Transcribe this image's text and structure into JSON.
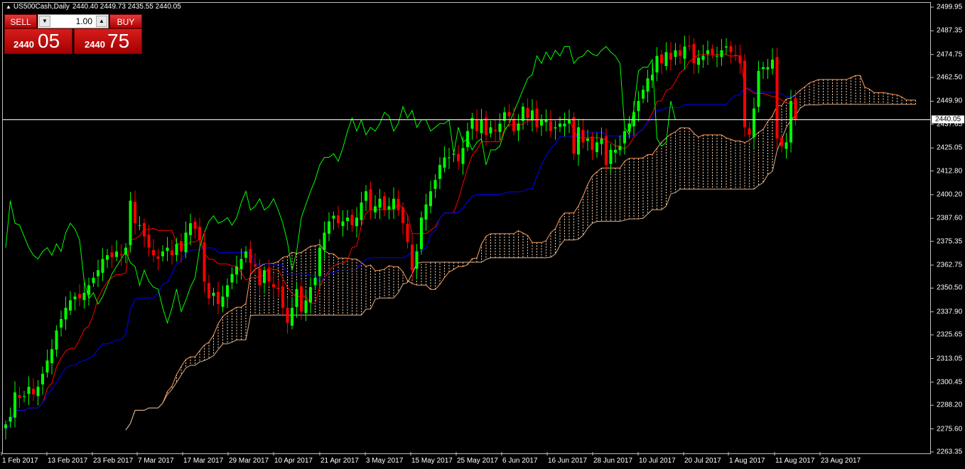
{
  "window": {
    "symbol": "US500Cash,Daily",
    "ohlc": "2440.40 2449.73 2435.55 2440.05"
  },
  "trade_panel": {
    "sell_label": "SELL",
    "buy_label": "BUY",
    "lot_value": "1.00",
    "sell_price_small": "2440",
    "sell_price_big": "05",
    "buy_price_small": "2440",
    "buy_price_big": "75"
  },
  "colors": {
    "background": "#000000",
    "bull": "#00ff00",
    "bear": "#ff0000",
    "tenkan": "#ff0000",
    "kijun": "#0000ff",
    "chikou": "#00ff00",
    "cloud": "#ffdab9",
    "axis_text": "#ffffff",
    "grid_border": "#c0c0c0"
  },
  "chart_data": {
    "type": "candlestick",
    "indicator": "Ichimoku Kinko Hyo",
    "current_price": 2440.05,
    "current_price_label": "2440.05",
    "y_ticks": [
      "2499.95",
      "2487.35",
      "2474.75",
      "2462.50",
      "2449.90",
      "2437.65",
      "2425.05",
      "2412.80",
      "2400.20",
      "2387.60",
      "2375.35",
      "2362.75",
      "2350.50",
      "2337.90",
      "2325.65",
      "2313.05",
      "2300.45",
      "2288.20",
      "2275.60",
      "2263.35"
    ],
    "x_labels": [
      "1 Feb 2017",
      "13 Feb 2017",
      "23 Feb 2017",
      "7 Mar 2017",
      "17 Mar 2017",
      "29 Mar 2017",
      "10 Apr 2017",
      "21 Apr 2017",
      "3 May 2017",
      "15 May 2017",
      "25 May 2017",
      "6 Jun 2017",
      "16 Jun 2017",
      "28 Jun 2017",
      "10 Jul 2017",
      "20 Jul 2017",
      "1 Aug 2017",
      "11 Aug 2017",
      "23 Aug 2017"
    ],
    "y_range": [
      2263.35,
      2499.95
    ],
    "close": [
      2278,
      2282,
      2295,
      2292,
      2293,
      2298,
      2294,
      2298,
      2305,
      2312,
      2318,
      2328,
      2334,
      2340,
      2344,
      2346,
      2345,
      2348,
      2352,
      2356,
      2360,
      2366,
      2368,
      2367,
      2370,
      2368,
      2372,
      2397,
      2385,
      2384,
      2378,
      2372,
      2368,
      2366,
      2370,
      2372,
      2368,
      2374,
      2370,
      2380,
      2385,
      2382,
      2376,
      2354,
      2345,
      2348,
      2342,
      2346,
      2352,
      2358,
      2362,
      2366,
      2370,
      2364,
      2362,
      2352,
      2360,
      2354,
      2351,
      2350,
      2340,
      2332,
      2340,
      2350,
      2338,
      2344,
      2351,
      2356,
      2372,
      2380,
      2386,
      2389,
      2385,
      2386,
      2388,
      2384,
      2388,
      2396,
      2402,
      2392,
      2394,
      2398,
      2392,
      2394,
      2398,
      2392,
      2385,
      2375,
      2360,
      2370,
      2388,
      2395,
      2402,
      2408,
      2416,
      2420,
      2420,
      2422,
      2418,
      2425,
      2434,
      2441,
      2434,
      2440,
      2432,
      2436,
      2434,
      2438,
      2444,
      2442,
      2434,
      2438,
      2447,
      2441,
      2445,
      2436,
      2440,
      2440,
      2434,
      2436,
      2438,
      2438,
      2440,
      2422,
      2436,
      2428,
      2430,
      2424,
      2428,
      2430,
      2416,
      2424,
      2424,
      2426,
      2434,
      2438,
      2444,
      2450,
      2456,
      2462,
      2464,
      2474,
      2470,
      2476,
      2472,
      2477,
      2474,
      2479,
      2479,
      2470,
      2473,
      2474,
      2477,
      2475,
      2474,
      2477,
      2479,
      2476,
      2474,
      2470,
      2436,
      2432,
      2446,
      2466,
      2468,
      2468,
      2472,
      2430,
      2426,
      2428,
      2450,
      2440
    ],
    "series": [
      {
        "name": "Tenkan-sen"
      },
      {
        "name": "Kijun-sen"
      },
      {
        "name": "Chikou Span"
      },
      {
        "name": "Senkou Span A"
      },
      {
        "name": "Senkou Span B"
      }
    ]
  }
}
